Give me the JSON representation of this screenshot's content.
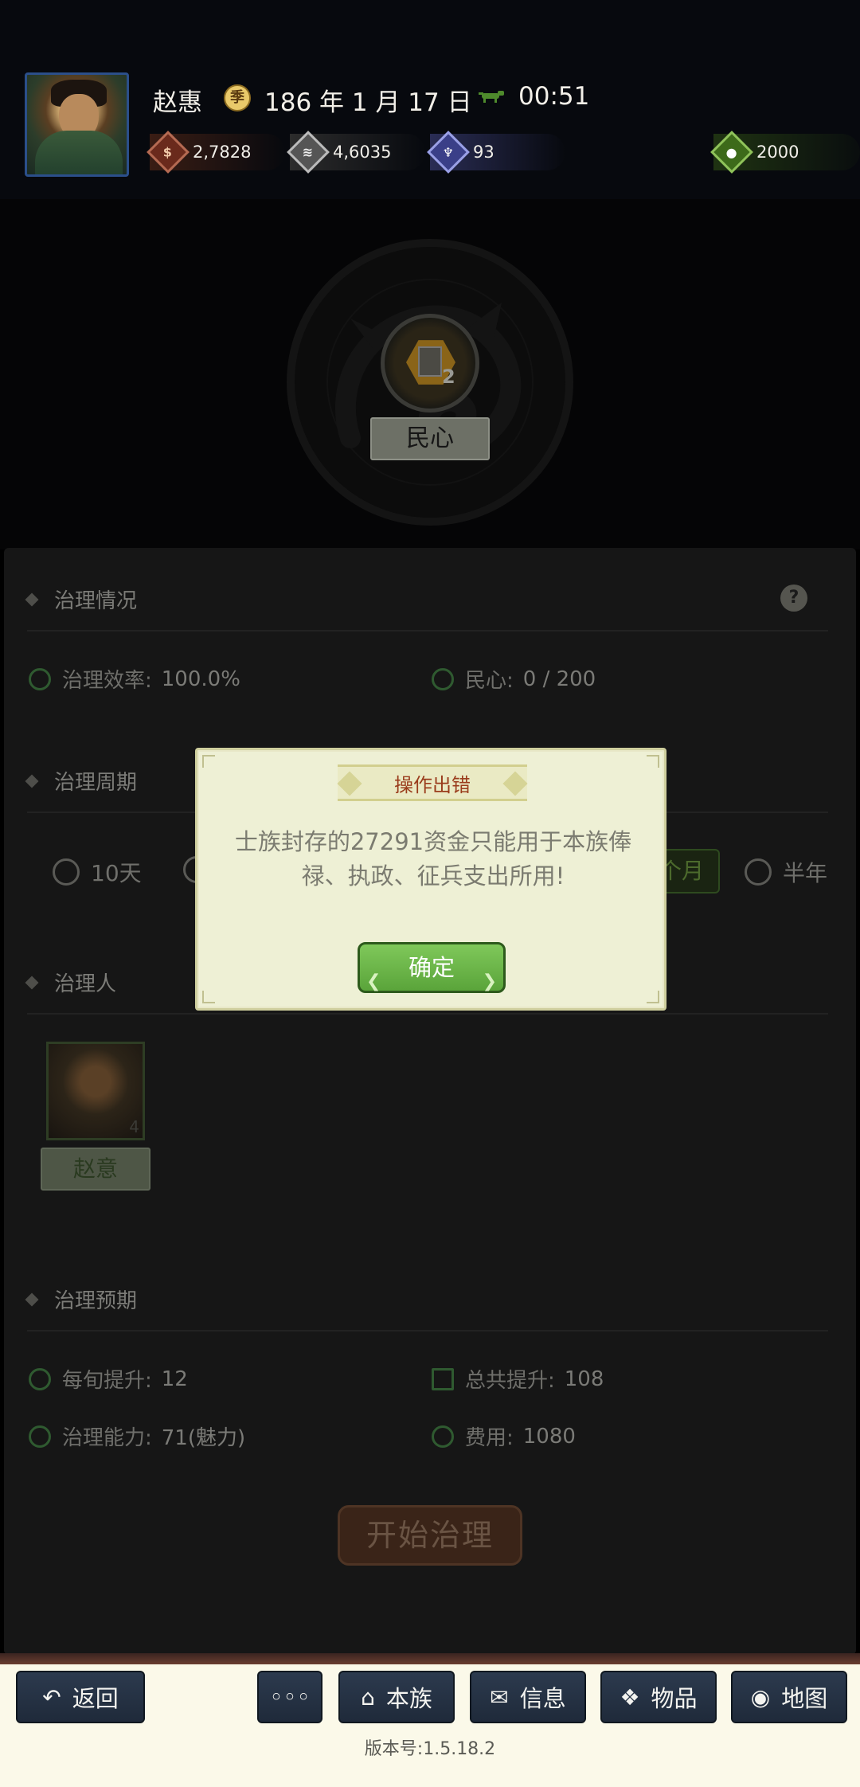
{
  "header": {
    "player_name": "赵惠",
    "season_icon": "季",
    "date": "186 年 1 月 17 日",
    "time": "00:51",
    "resources": {
      "gold": "2,7828",
      "grain": "4,6035",
      "troops": "93",
      "coin": "2000"
    },
    "center_label": "民心",
    "center_badge": "2"
  },
  "panel": {
    "status": {
      "title": "治理情况",
      "help": "?",
      "efficiency_label": "治理效率:",
      "efficiency_value": "100.0%",
      "minxin_label": "民心:",
      "minxin_value": "0 / 200"
    },
    "cycle": {
      "title": "治理周期",
      "opt_10d": "10天",
      "opt_month_visible": "个月",
      "opt_halfyear": "半年"
    },
    "governor": {
      "title": "治理人",
      "name": "赵意",
      "portrait_badge": "4"
    },
    "forecast": {
      "title": "治理预期",
      "per_period_label": "每旬提升:",
      "per_period_value": "12",
      "total_label": "总共提升:",
      "total_value": "108",
      "ability_label": "治理能力:",
      "ability_value": "71(魅力)",
      "cost_label": "费用:",
      "cost_value": "1080"
    },
    "start_button": "开始治理"
  },
  "dialog": {
    "title": "操作出错",
    "message": "士族封存的27291资金只能用于本族俸禄、执政、征兵支出所用!",
    "ok": "确定"
  },
  "bottom_nav": {
    "back": "返回",
    "more": "◦◦◦",
    "clan": "本族",
    "info": "信息",
    "items": "物品",
    "map": "地图",
    "version": "版本号:1.5.18.2"
  }
}
